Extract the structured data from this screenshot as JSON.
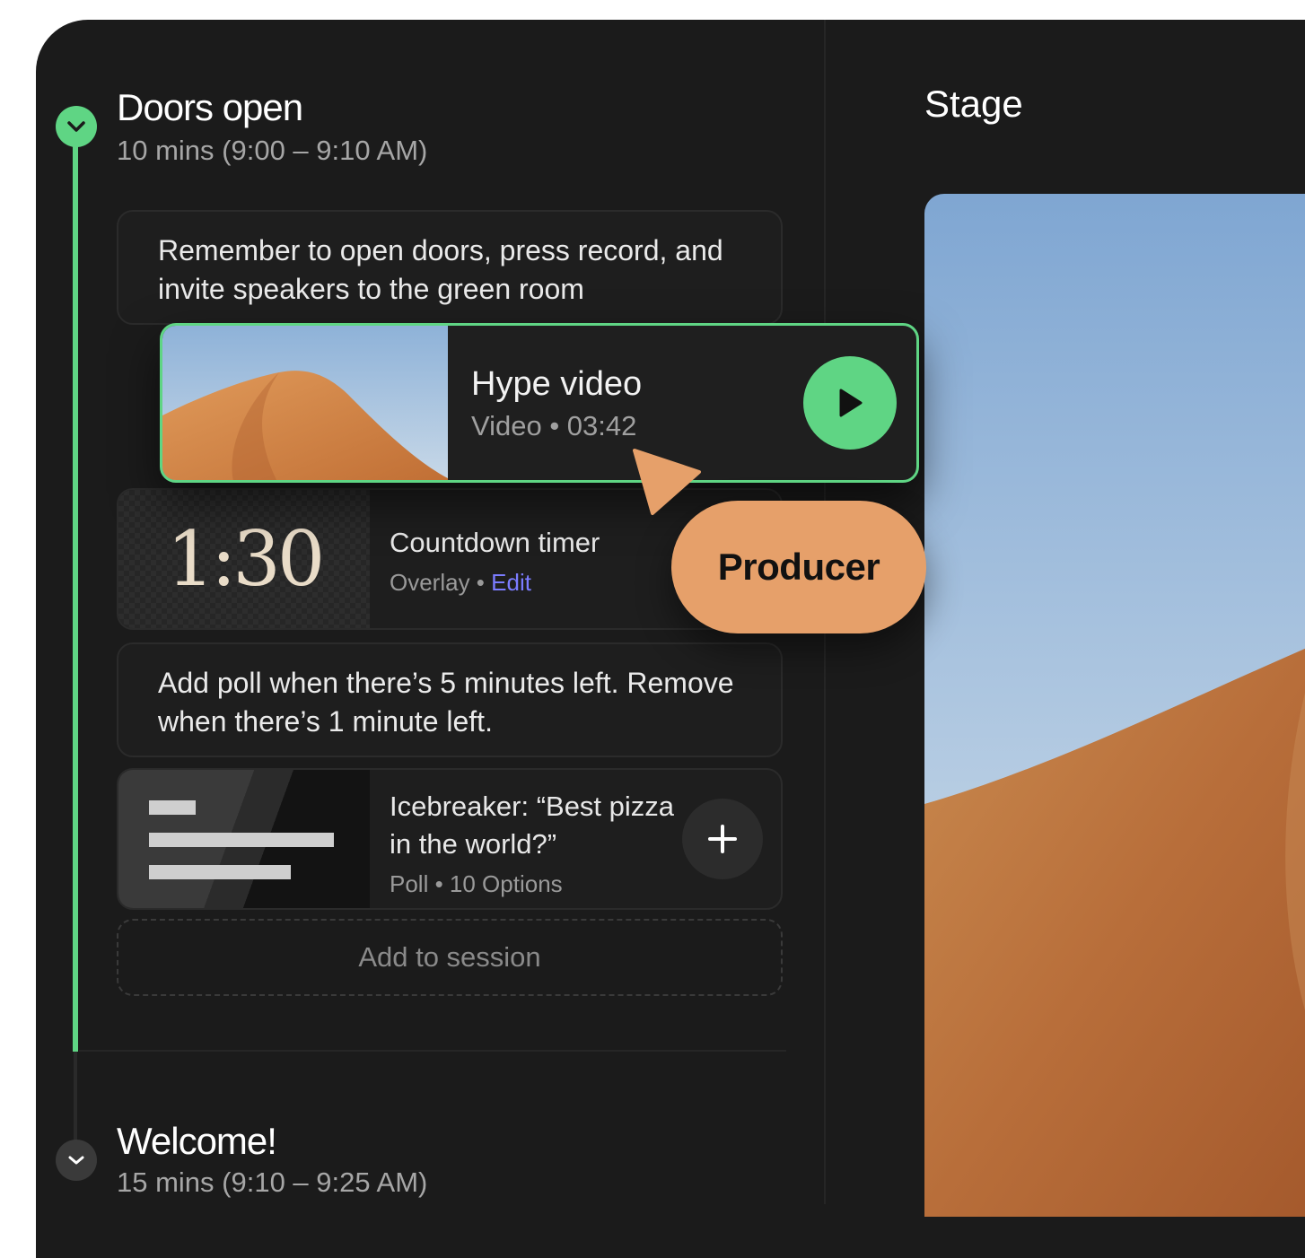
{
  "sections": [
    {
      "title": "Doors open",
      "subtitle": "10 mins (9:00 – 9:10 AM)"
    },
    {
      "title": "Welcome!",
      "subtitle": "15 mins (9:10 – 9:25 AM)"
    }
  ],
  "items": {
    "note_1": "Remember to open doors, press record, and invite speakers to the green room",
    "hype_video": {
      "title": "Hype video",
      "meta": "Video • 03:42"
    },
    "countdown": {
      "display": "1:30",
      "title": "Countdown timer",
      "meta_prefix": "Overlay • ",
      "edit_label": "Edit"
    },
    "note_2": "Add poll when there’s 5 minutes left. Remove when there’s 1 minute left.",
    "poll": {
      "title": "Icebreaker: “Best pizza in the world?”",
      "meta": "Poll • 10 Options"
    }
  },
  "add_session_label": "Add to session",
  "stage": {
    "title": "Stage"
  },
  "producer": {
    "label": "Producer"
  },
  "icons": {
    "section_check": "chevron-down-icon",
    "play": "play-icon",
    "add": "plus-icon"
  },
  "colors": {
    "accent_green": "#5fd584",
    "producer_orange": "#e6a06a",
    "link_purple": "#7b7cff",
    "panel_bg": "#1b1b1b"
  }
}
